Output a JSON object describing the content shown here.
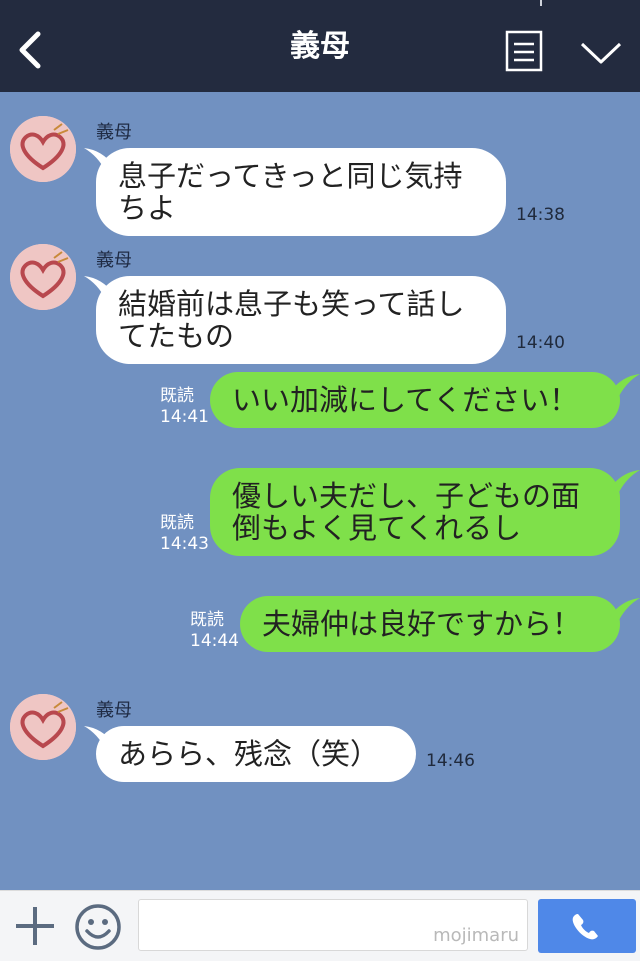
{
  "header": {
    "title": "義母",
    "back_icon": "chevron-left-icon",
    "notes_icon": "notes-icon",
    "menu_icon": "chevron-down-icon",
    "bg_color": "#232b3f"
  },
  "chat": {
    "bg_color": "#7191c1",
    "incoming_color": "#ffffff",
    "outgoing_color": "#7fe04a",
    "messages": [
      {
        "direction": "in",
        "sender": "義母",
        "text": "息子だってきっと同じ気持\nちよ",
        "time": "14:38"
      },
      {
        "direction": "in",
        "sender": "義母",
        "text": "結婚前は息子も笑って話し\nてたもの",
        "time": "14:40"
      },
      {
        "direction": "out",
        "read": "既読",
        "text": "いい加減にしてください！",
        "time": "14:41"
      },
      {
        "direction": "out",
        "read": "既読",
        "text": "優しい夫だし、子どもの面\n倒もよく見てくれるし",
        "time": "14:43"
      },
      {
        "direction": "out",
        "read": "既読",
        "text": "夫婦仲は良好ですから！",
        "time": "14:44"
      },
      {
        "direction": "in",
        "sender": "義母",
        "text": "あらら、残念（笑）",
        "time": "14:46"
      }
    ]
  },
  "input_bar": {
    "plus_icon": "plus-icon",
    "emoji_icon": "smiley-icon",
    "placeholder": "",
    "watermark": "mojimaru",
    "call_icon": "phone-icon",
    "call_button_color": "#4f88e8"
  }
}
